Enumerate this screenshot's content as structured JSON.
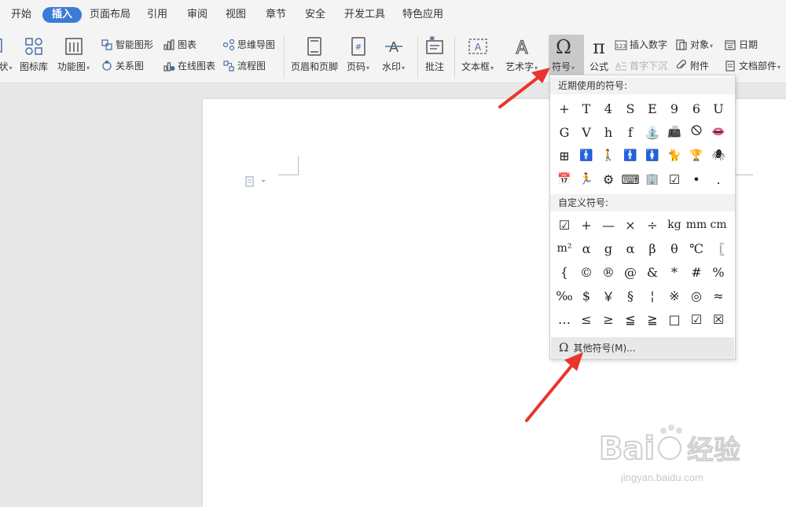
{
  "menu": {
    "tabs": [
      "开始",
      "插入",
      "页面布局",
      "引用",
      "审阅",
      "视图",
      "章节",
      "安全",
      "开发工具",
      "特色应用"
    ],
    "active_tab": "插入",
    "accent_color": "#3a7bd5"
  },
  "ribbon": {
    "cut_label": "状",
    "icon_lib": "图标库",
    "func_chart": "功能图",
    "smart_shape": "智能图形",
    "chart": "图表",
    "mind_map": "思维导图",
    "relation": "关系图",
    "online_chart": "在线图表",
    "flow": "流程图",
    "header_footer": "页眉和页脚",
    "page_num": "页码",
    "watermark": "水印",
    "comment": "批注",
    "textbox": "文本框",
    "wordart": "艺术字",
    "symbol": "符号",
    "formula": "公式",
    "insert_num": "插入数字",
    "first_sink": "首字下沉",
    "object": "对象",
    "attach": "附件",
    "date": "日期",
    "doc_parts": "文档部件"
  },
  "symbol_dropdown": {
    "recent_title": "近期使用的符号:",
    "recent": [
      "+",
      "T",
      "4",
      "S",
      "E",
      "9",
      "6",
      "U",
      "G",
      "V",
      "h",
      "f",
      "⛲",
      "📠",
      "🛇",
      "👄",
      "⊞",
      "🚹",
      "🚶",
      "🚹",
      "🚺",
      "🐈",
      "🏆",
      "🕷",
      "📅",
      "🏃",
      "⚙",
      "⌨",
      "🏢",
      "☑",
      "•",
      "."
    ],
    "custom_title": "自定义符号:",
    "custom": [
      "☑",
      "+",
      "—",
      "×",
      "÷",
      "kg",
      "mm",
      "cm",
      "m²",
      "α",
      "g",
      "α",
      "β",
      "θ",
      "℃",
      "〖",
      "{",
      "©",
      "®",
      "@",
      "&",
      "*",
      "#",
      "%",
      "‰",
      "$",
      "￥",
      "§",
      "¦",
      "※",
      "◎",
      "≈",
      "…",
      "≤",
      "≥",
      "≦",
      "≧",
      "□",
      "☑",
      "☒"
    ],
    "more_label": "其他符号(M)...",
    "more_icon": "Ω"
  },
  "watermark": {
    "brand": "Bai 经验",
    "url": "jingyan.baidu.com"
  },
  "colors": {
    "arrow": "#e8352d"
  }
}
